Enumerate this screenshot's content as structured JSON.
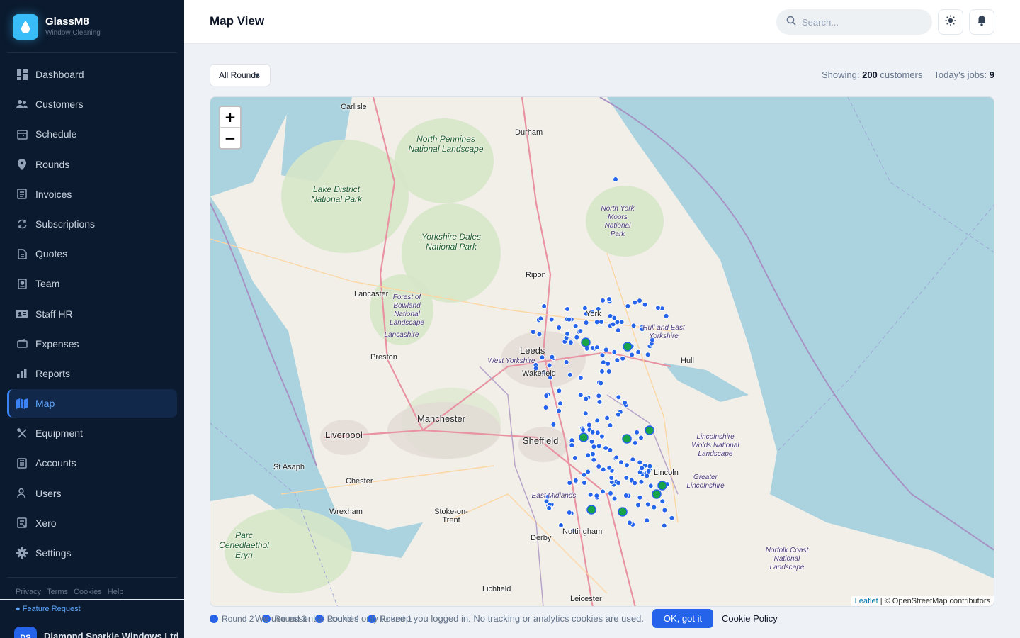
{
  "app": {
    "name": "GlassM8",
    "subtitle": "Window Cleaning"
  },
  "nav": [
    {
      "label": "Dashboard",
      "icon": "dashboard-icon"
    },
    {
      "label": "Customers",
      "icon": "users-icon"
    },
    {
      "label": "Schedule",
      "icon": "calendar-icon"
    },
    {
      "label": "Rounds",
      "icon": "map-pin-icon"
    },
    {
      "label": "Invoices",
      "icon": "invoice-icon"
    },
    {
      "label": "Subscriptions",
      "icon": "refresh-icon"
    },
    {
      "label": "Quotes",
      "icon": "document-icon"
    },
    {
      "label": "Team",
      "icon": "id-badge-icon"
    },
    {
      "label": "Staff HR",
      "icon": "id-card-icon"
    },
    {
      "label": "Expenses",
      "icon": "wallet-icon"
    },
    {
      "label": "Reports",
      "icon": "bar-chart-icon"
    },
    {
      "label": "Map",
      "icon": "map-icon",
      "active": true
    },
    {
      "label": "Equipment",
      "icon": "tools-icon"
    },
    {
      "label": "Accounts",
      "icon": "ledger-icon"
    },
    {
      "label": "Users",
      "icon": "user-icon"
    },
    {
      "label": "Xero",
      "icon": "xero-icon"
    },
    {
      "label": "Settings",
      "icon": "gear-icon"
    }
  ],
  "footer": {
    "links": [
      "Privacy",
      "Terms",
      "Cookies",
      "Help"
    ],
    "feature_request": "Feature Request",
    "company_initials": "DS",
    "company_name": "Diamond Sparkle Windows Ltd"
  },
  "header": {
    "title": "Map View",
    "search_placeholder": "Search..."
  },
  "toolbar": {
    "round_filter": "All Rounds",
    "showing_label": "Showing:",
    "showing_count": "200",
    "showing_unit": "customers",
    "jobs_label": "Today's jobs:",
    "jobs_count": "9"
  },
  "map": {
    "zoom_in": "+",
    "zoom_out": "−",
    "attribution_leaflet": "Leaflet",
    "attribution_osm": "| © OpenStreetMap contributors",
    "places": [
      "Carlisle",
      "Durham",
      "North Pennines National Landscape",
      "Lake District National Park",
      "North York Moors National Park",
      "Yorkshire Dales National Park",
      "Ripon",
      "Lancaster",
      "Forest of Bowland National Landscape",
      "Lancashire",
      "York",
      "Hull and East Yorkshire",
      "Preston",
      "Leeds",
      "West Yorkshire",
      "Wakefield",
      "Hull",
      "Manchester",
      "Liverpool",
      "Sheffield",
      "Lincolnshire Wolds National Landscape",
      "St Asaph",
      "Lincoln",
      "Greater Lincolnshire",
      "Chester",
      "East Midlands",
      "Wrexham",
      "Stoke-on-Trent",
      "Nottingham",
      "Parc Cenedlaethol Eryri",
      "Derby",
      "Norfolk Coast National Landscape",
      "Lichfield",
      "Leicester"
    ],
    "job_color": "#16a34a",
    "customer_color": "#2563eb"
  },
  "legend": [
    {
      "label": "Round 2",
      "color": "#2563eb"
    },
    {
      "label": "Round 3",
      "color": "#2563eb"
    },
    {
      "label": "Round 4",
      "color": "#2563eb"
    },
    {
      "label": "Round 1",
      "color": "#2563eb"
    }
  ],
  "cookie": {
    "text": "We use essential cookies only to keep you logged in. No tracking or analytics cookies are used.",
    "button": "OK, got it",
    "link": "Cookie Policy"
  }
}
